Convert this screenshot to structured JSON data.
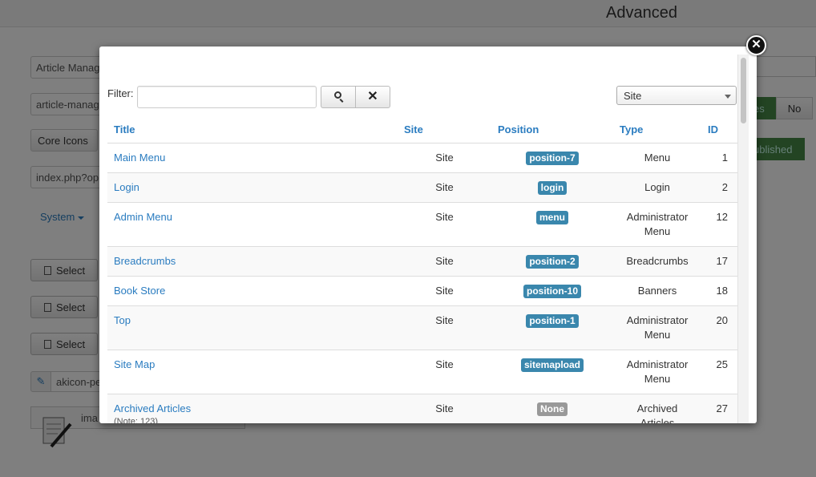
{
  "background": {
    "heading": "Advanced",
    "fields": [
      "Article Manag",
      "article-manag",
      "Core Icons",
      "index.php?op"
    ],
    "system_label": "System",
    "select_label": "Select",
    "akicon_value": "akicon-pe",
    "image_value": "ima",
    "yes_label": "es",
    "no_label": "No",
    "published_label": "ublished"
  },
  "modal": {
    "filter_label": "Filter:",
    "filter_value": "",
    "site_select": "Site",
    "columns": {
      "title": "Title",
      "site": "Site",
      "position": "Position",
      "type": "Type",
      "id": "ID"
    },
    "rows": [
      {
        "title": "Main Menu",
        "note": "",
        "site": "Site",
        "position": "position-7",
        "type": "Menu",
        "id": "1"
      },
      {
        "title": "Login",
        "note": "",
        "site": "Site",
        "position": "login",
        "type": "Login",
        "id": "2"
      },
      {
        "title": "Admin Menu",
        "note": "",
        "site": "Site",
        "position": "menu",
        "type": "Administrator Menu",
        "id": "12"
      },
      {
        "title": "Breadcrumbs",
        "note": "",
        "site": "Site",
        "position": "position-2",
        "type": "Breadcrumbs",
        "id": "17"
      },
      {
        "title": "Book Store",
        "note": "",
        "site": "Site",
        "position": "position-10",
        "type": "Banners",
        "id": "18"
      },
      {
        "title": "Top",
        "note": "",
        "site": "Site",
        "position": "position-1",
        "type": "Administrator Menu",
        "id": "20"
      },
      {
        "title": "Site Map",
        "note": "",
        "site": "Site",
        "position": "sitemapload",
        "type": "Administrator Menu",
        "id": "25"
      },
      {
        "title": "Archived Articles",
        "note": "(Note: 123)",
        "site": "Site",
        "position": "None",
        "type": "Archived Articles",
        "id": "27"
      }
    ]
  },
  "colors": {
    "link": "#2a7cc0",
    "badge": "#3a87ad",
    "badge_none": "#999999",
    "published_green": "#468847"
  }
}
